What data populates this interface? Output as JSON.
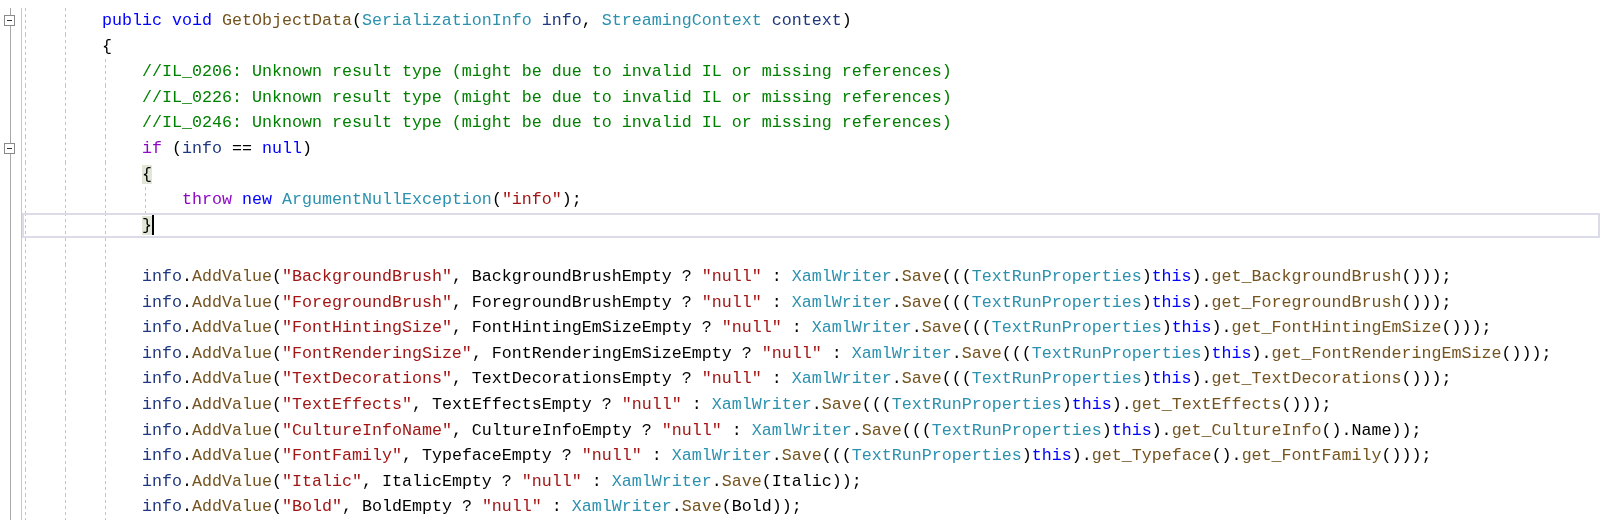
{
  "editor": {
    "lines": [
      {
        "fold_marker": true,
        "brace_match": false,
        "current": false,
        "tokens": [
          {
            "kind": "keyword",
            "text": "public void"
          },
          {
            "kind": "method",
            "text": " GetObjectData"
          },
          {
            "kind": "plain",
            "text": "("
          },
          {
            "kind": "type",
            "text": "SerializationInfo"
          },
          {
            "kind": "param",
            "text": " info"
          },
          {
            "kind": "plain",
            "text": ", "
          },
          {
            "kind": "type",
            "text": "StreamingContext"
          },
          {
            "kind": "param",
            "text": " context"
          },
          {
            "kind": "plain",
            "text": ")"
          }
        ]
      },
      {
        "fold_marker": false,
        "brace_match": false,
        "current": false,
        "tokens": [
          {
            "kind": "plain",
            "text": "{"
          }
        ],
        "children": [
          {
            "fold_marker": false,
            "brace_match": false,
            "current": false,
            "tokens": [
              {
                "kind": "comment",
                "text": "//IL_0206: Unknown result type (might be due to invalid IL or missing references)"
              }
            ]
          },
          {
            "fold_marker": false,
            "brace_match": false,
            "current": false,
            "tokens": [
              {
                "kind": "comment",
                "text": "//IL_0226: Unknown result type (might be due to invalid IL or missing references)"
              }
            ]
          },
          {
            "fold_marker": false,
            "brace_match": false,
            "current": false,
            "tokens": [
              {
                "kind": "comment",
                "text": "//IL_0246: Unknown result type (might be due to invalid IL or missing references)"
              }
            ]
          },
          {
            "fold_marker": true,
            "brace_match": false,
            "current": false,
            "tokens": [
              {
                "kind": "control",
                "text": "if"
              },
              {
                "kind": "plain",
                "text": " ("
              },
              {
                "kind": "param",
                "text": "info"
              },
              {
                "kind": "plain",
                "text": " == "
              },
              {
                "kind": "keyword",
                "text": "null"
              },
              {
                "kind": "plain",
                "text": ")"
              }
            ]
          },
          {
            "fold_marker": false,
            "brace_match": true,
            "current": false,
            "tokens": [
              {
                "kind": "plain",
                "text": "{"
              }
            ],
            "children": [
              {
                "fold_marker": false,
                "brace_match": false,
                "current": false,
                "tokens": [
                  {
                    "kind": "control",
                    "text": "throw"
                  },
                  {
                    "kind": "keyword",
                    "text": " new"
                  },
                  {
                    "kind": "type",
                    "text": " ArgumentNullException"
                  },
                  {
                    "kind": "plain",
                    "text": "("
                  },
                  {
                    "kind": "string",
                    "text": "\"info\""
                  },
                  {
                    "kind": "plain",
                    "text": ");"
                  }
                ]
              }
            ]
          },
          {
            "fold_marker": false,
            "brace_match": true,
            "current": true,
            "tokens": [
              {
                "kind": "plain",
                "text": "}"
              }
            ]
          },
          {
            "fold_marker": false,
            "brace_match": false,
            "current": false
          },
          {
            "fold_marker": false,
            "brace_match": false,
            "current": false,
            "tokens": [
              {
                "kind": "param",
                "text": "info"
              },
              {
                "kind": "plain",
                "text": "."
              },
              {
                "kind": "method",
                "text": "AddValue"
              },
              {
                "kind": "plain",
                "text": "("
              },
              {
                "kind": "string",
                "text": "\"BackgroundBrush\""
              },
              {
                "kind": "plain",
                "text": ", BackgroundBrushEmpty ? "
              },
              {
                "kind": "string",
                "text": "\"null\""
              },
              {
                "kind": "plain",
                "text": " : "
              },
              {
                "kind": "type",
                "text": "XamlWriter"
              },
              {
                "kind": "plain",
                "text": "."
              },
              {
                "kind": "method",
                "text": "Save"
              },
              {
                "kind": "plain",
                "text": "((("
              },
              {
                "kind": "type",
                "text": "TextRunProperties"
              },
              {
                "kind": "plain",
                "text": ")"
              },
              {
                "kind": "keyword",
                "text": "this"
              },
              {
                "kind": "plain",
                "text": ")."
              },
              {
                "kind": "method",
                "text": "get_BackgroundBrush"
              },
              {
                "kind": "plain",
                "text": "()));"
              }
            ]
          },
          {
            "fold_marker": false,
            "brace_match": false,
            "current": false,
            "tokens": [
              {
                "kind": "param",
                "text": "info"
              },
              {
                "kind": "plain",
                "text": "."
              },
              {
                "kind": "method",
                "text": "AddValue"
              },
              {
                "kind": "plain",
                "text": "("
              },
              {
                "kind": "string",
                "text": "\"ForegroundBrush\""
              },
              {
                "kind": "plain",
                "text": ", ForegroundBrushEmpty ? "
              },
              {
                "kind": "string",
                "text": "\"null\""
              },
              {
                "kind": "plain",
                "text": " : "
              },
              {
                "kind": "type",
                "text": "XamlWriter"
              },
              {
                "kind": "plain",
                "text": "."
              },
              {
                "kind": "method",
                "text": "Save"
              },
              {
                "kind": "plain",
                "text": "((("
              },
              {
                "kind": "type",
                "text": "TextRunProperties"
              },
              {
                "kind": "plain",
                "text": ")"
              },
              {
                "kind": "keyword",
                "text": "this"
              },
              {
                "kind": "plain",
                "text": ")."
              },
              {
                "kind": "method",
                "text": "get_ForegroundBrush"
              },
              {
                "kind": "plain",
                "text": "()));"
              }
            ]
          },
          {
            "fold_marker": false,
            "brace_match": false,
            "current": false,
            "tokens": [
              {
                "kind": "param",
                "text": "info"
              },
              {
                "kind": "plain",
                "text": "."
              },
              {
                "kind": "method",
                "text": "AddValue"
              },
              {
                "kind": "plain",
                "text": "("
              },
              {
                "kind": "string",
                "text": "\"FontHintingSize\""
              },
              {
                "kind": "plain",
                "text": ", FontHintingEmSizeEmpty ? "
              },
              {
                "kind": "string",
                "text": "\"null\""
              },
              {
                "kind": "plain",
                "text": " : "
              },
              {
                "kind": "type",
                "text": "XamlWriter"
              },
              {
                "kind": "plain",
                "text": "."
              },
              {
                "kind": "method",
                "text": "Save"
              },
              {
                "kind": "plain",
                "text": "((("
              },
              {
                "kind": "type",
                "text": "TextRunProperties"
              },
              {
                "kind": "plain",
                "text": ")"
              },
              {
                "kind": "keyword",
                "text": "this"
              },
              {
                "kind": "plain",
                "text": ")."
              },
              {
                "kind": "method",
                "text": "get_FontHintingEmSize"
              },
              {
                "kind": "plain",
                "text": "()));"
              }
            ]
          },
          {
            "fold_marker": false,
            "brace_match": false,
            "current": false,
            "tokens": [
              {
                "kind": "param",
                "text": "info"
              },
              {
                "kind": "plain",
                "text": "."
              },
              {
                "kind": "method",
                "text": "AddValue"
              },
              {
                "kind": "plain",
                "text": "("
              },
              {
                "kind": "string",
                "text": "\"FontRenderingSize\""
              },
              {
                "kind": "plain",
                "text": ", FontRenderingEmSizeEmpty ? "
              },
              {
                "kind": "string",
                "text": "\"null\""
              },
              {
                "kind": "plain",
                "text": " : "
              },
              {
                "kind": "type",
                "text": "XamlWriter"
              },
              {
                "kind": "plain",
                "text": "."
              },
              {
                "kind": "method",
                "text": "Save"
              },
              {
                "kind": "plain",
                "text": "((("
              },
              {
                "kind": "type",
                "text": "TextRunProperties"
              },
              {
                "kind": "plain",
                "text": ")"
              },
              {
                "kind": "keyword",
                "text": "this"
              },
              {
                "kind": "plain",
                "text": ")."
              },
              {
                "kind": "method",
                "text": "get_FontRenderingEmSize"
              },
              {
                "kind": "plain",
                "text": "()));"
              }
            ]
          },
          {
            "fold_marker": false,
            "brace_match": false,
            "current": false,
            "tokens": [
              {
                "kind": "param",
                "text": "info"
              },
              {
                "kind": "plain",
                "text": "."
              },
              {
                "kind": "method",
                "text": "AddValue"
              },
              {
                "kind": "plain",
                "text": "("
              },
              {
                "kind": "string",
                "text": "\"TextDecorations\""
              },
              {
                "kind": "plain",
                "text": ", TextDecorationsEmpty ? "
              },
              {
                "kind": "string",
                "text": "\"null\""
              },
              {
                "kind": "plain",
                "text": " : "
              },
              {
                "kind": "type",
                "text": "XamlWriter"
              },
              {
                "kind": "plain",
                "text": "."
              },
              {
                "kind": "method",
                "text": "Save"
              },
              {
                "kind": "plain",
                "text": "((("
              },
              {
                "kind": "type",
                "text": "TextRunProperties"
              },
              {
                "kind": "plain",
                "text": ")"
              },
              {
                "kind": "keyword",
                "text": "this"
              },
              {
                "kind": "plain",
                "text": ")."
              },
              {
                "kind": "method",
                "text": "get_TextDecorations"
              },
              {
                "kind": "plain",
                "text": "()));"
              }
            ]
          },
          {
            "fold_marker": false,
            "brace_match": false,
            "current": false,
            "tokens": [
              {
                "kind": "param",
                "text": "info"
              },
              {
                "kind": "plain",
                "text": "."
              },
              {
                "kind": "method",
                "text": "AddValue"
              },
              {
                "kind": "plain",
                "text": "("
              },
              {
                "kind": "string",
                "text": "\"TextEffects\""
              },
              {
                "kind": "plain",
                "text": ", TextEffectsEmpty ? "
              },
              {
                "kind": "string",
                "text": "\"null\""
              },
              {
                "kind": "plain",
                "text": " : "
              },
              {
                "kind": "type",
                "text": "XamlWriter"
              },
              {
                "kind": "plain",
                "text": "."
              },
              {
                "kind": "method",
                "text": "Save"
              },
              {
                "kind": "plain",
                "text": "((("
              },
              {
                "kind": "type",
                "text": "TextRunProperties"
              },
              {
                "kind": "plain",
                "text": ")"
              },
              {
                "kind": "keyword",
                "text": "this"
              },
              {
                "kind": "plain",
                "text": ")."
              },
              {
                "kind": "method",
                "text": "get_TextEffects"
              },
              {
                "kind": "plain",
                "text": "()));"
              }
            ]
          },
          {
            "fold_marker": false,
            "brace_match": false,
            "current": false,
            "tokens": [
              {
                "kind": "param",
                "text": "info"
              },
              {
                "kind": "plain",
                "text": "."
              },
              {
                "kind": "method",
                "text": "AddValue"
              },
              {
                "kind": "plain",
                "text": "("
              },
              {
                "kind": "string",
                "text": "\"CultureInfoName\""
              },
              {
                "kind": "plain",
                "text": ", CultureInfoEmpty ? "
              },
              {
                "kind": "string",
                "text": "\"null\""
              },
              {
                "kind": "plain",
                "text": " : "
              },
              {
                "kind": "type",
                "text": "XamlWriter"
              },
              {
                "kind": "plain",
                "text": "."
              },
              {
                "kind": "method",
                "text": "Save"
              },
              {
                "kind": "plain",
                "text": "((("
              },
              {
                "kind": "type",
                "text": "TextRunProperties"
              },
              {
                "kind": "plain",
                "text": ")"
              },
              {
                "kind": "keyword",
                "text": "this"
              },
              {
                "kind": "plain",
                "text": ")."
              },
              {
                "kind": "method",
                "text": "get_CultureInfo"
              },
              {
                "kind": "plain",
                "text": "().Name));"
              }
            ]
          },
          {
            "fold_marker": false,
            "brace_match": false,
            "current": false,
            "tokens": [
              {
                "kind": "param",
                "text": "info"
              },
              {
                "kind": "plain",
                "text": "."
              },
              {
                "kind": "method",
                "text": "AddValue"
              },
              {
                "kind": "plain",
                "text": "("
              },
              {
                "kind": "string",
                "text": "\"FontFamily\""
              },
              {
                "kind": "plain",
                "text": ", TypefaceEmpty ? "
              },
              {
                "kind": "string",
                "text": "\"null\""
              },
              {
                "kind": "plain",
                "text": " : "
              },
              {
                "kind": "type",
                "text": "XamlWriter"
              },
              {
                "kind": "plain",
                "text": "."
              },
              {
                "kind": "method",
                "text": "Save"
              },
              {
                "kind": "plain",
                "text": "((("
              },
              {
                "kind": "type",
                "text": "TextRunProperties"
              },
              {
                "kind": "plain",
                "text": ")"
              },
              {
                "kind": "keyword",
                "text": "this"
              },
              {
                "kind": "plain",
                "text": ")."
              },
              {
                "kind": "method",
                "text": "get_Typeface"
              },
              {
                "kind": "plain",
                "text": "()."
              },
              {
                "kind": "method",
                "text": "get_FontFamily"
              },
              {
                "kind": "plain",
                "text": "()));"
              }
            ]
          },
          {
            "fold_marker": false,
            "brace_match": false,
            "current": false,
            "tokens": [
              {
                "kind": "param",
                "text": "info"
              },
              {
                "kind": "plain",
                "text": "."
              },
              {
                "kind": "method",
                "text": "AddValue"
              },
              {
                "kind": "plain",
                "text": "("
              },
              {
                "kind": "string",
                "text": "\"Italic\""
              },
              {
                "kind": "plain",
                "text": ", ItalicEmpty ? "
              },
              {
                "kind": "string",
                "text": "\"null\""
              },
              {
                "kind": "plain",
                "text": " : "
              },
              {
                "kind": "type",
                "text": "XamlWriter"
              },
              {
                "kind": "plain",
                "text": "."
              },
              {
                "kind": "method",
                "text": "Save"
              },
              {
                "kind": "plain",
                "text": "(Italic));"
              }
            ]
          },
          {
            "fold_marker": false,
            "brace_match": false,
            "current": false,
            "tokens": [
              {
                "kind": "param",
                "text": "info"
              },
              {
                "kind": "plain",
                "text": "."
              },
              {
                "kind": "method",
                "text": "AddValue"
              },
              {
                "kind": "plain",
                "text": "("
              },
              {
                "kind": "string",
                "text": "\"Bold\""
              },
              {
                "kind": "plain",
                "text": ", BoldEmpty ? "
              },
              {
                "kind": "string",
                "text": "\"null\""
              },
              {
                "kind": "plain",
                "text": " : "
              },
              {
                "kind": "type",
                "text": "XamlWriter"
              },
              {
                "kind": "plain",
                "text": "."
              },
              {
                "kind": "method",
                "text": "Save"
              },
              {
                "kind": "plain",
                "text": "(Bold));"
              }
            ]
          }
        ]
      }
    ]
  }
}
